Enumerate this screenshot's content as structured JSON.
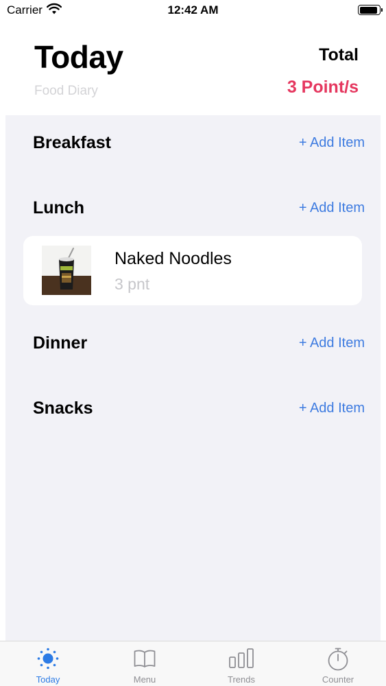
{
  "status_bar": {
    "carrier": "Carrier",
    "time": "12:42 AM",
    "battery_level": 0.92
  },
  "header": {
    "title": "Today",
    "subtitle": "Food Diary",
    "total_label": "Total",
    "total_value": "3 Point/s"
  },
  "sections": [
    {
      "title": "Breakfast",
      "add_label": "+ Add Item"
    },
    {
      "title": "Lunch",
      "add_label": "+ Add Item"
    },
    {
      "title": "Dinner",
      "add_label": "+ Add Item"
    },
    {
      "title": "Snacks",
      "add_label": "+ Add Item"
    }
  ],
  "lunch_items": [
    {
      "name": "Naked Noodles",
      "points": "3 pnt"
    }
  ],
  "tab_bar": {
    "tabs": [
      {
        "label": "Today",
        "icon": "sun-icon",
        "active": true
      },
      {
        "label": "Menu",
        "icon": "book-icon",
        "active": false
      },
      {
        "label": "Trends",
        "icon": "bar-chart-icon",
        "active": false
      },
      {
        "label": "Counter",
        "icon": "stopwatch-icon",
        "active": false
      }
    ]
  },
  "colors": {
    "accent": "#2c7be5",
    "link": "#3d7be0",
    "total_value": "#e5365e",
    "background_grouped": "#f2f2f7"
  }
}
